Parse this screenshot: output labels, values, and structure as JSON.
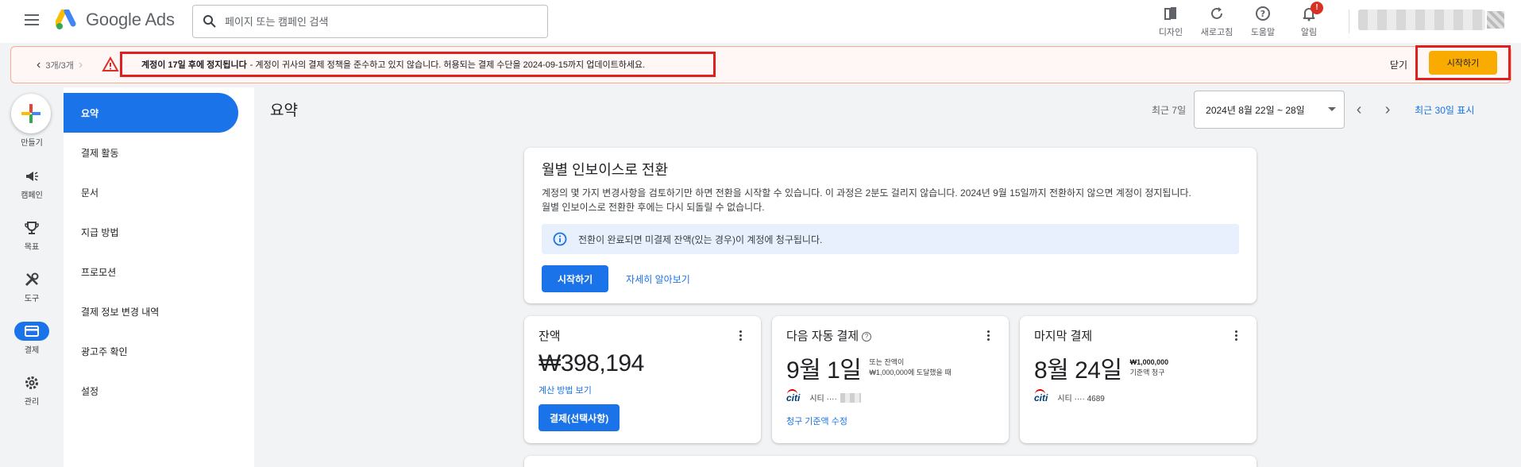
{
  "app": {
    "title": "Google Ads"
  },
  "search": {
    "placeholder": "페이지 또는 캠페인 검색"
  },
  "top_actions": [
    {
      "label": "디자인",
      "icon": "appearance-icon"
    },
    {
      "label": "새로고침",
      "icon": "refresh-icon"
    },
    {
      "label": "도움말",
      "icon": "help-icon"
    },
    {
      "label": "알림",
      "icon": "bell-icon",
      "badge": "!"
    }
  ],
  "banner": {
    "counter": "3개/3개",
    "headline": "계정이 17일 후에 정지됩니다",
    "message": "- 계정이 귀사의 결제 정책을 준수하고 있지 않습니다. 허용되는 결제 수단을 2024-09-15까지 업데이트하세요.",
    "close_label": "닫기",
    "cta_label": "시작하기"
  },
  "rail": {
    "create_label": "만들기",
    "items": [
      {
        "label": "캠페인",
        "icon": "megaphone-icon"
      },
      {
        "label": "목표",
        "icon": "trophy-icon"
      },
      {
        "label": "도구",
        "icon": "tools-icon"
      },
      {
        "label": "결제",
        "icon": "credit-card-icon",
        "active": true
      },
      {
        "label": "관리",
        "icon": "gear-icon"
      }
    ]
  },
  "subnav": {
    "items": [
      {
        "label": "요약",
        "active": true
      },
      {
        "label": "결제 활동"
      },
      {
        "label": "문서"
      },
      {
        "label": "지급 방법"
      },
      {
        "label": "프로모션"
      },
      {
        "label": "결제 정보 변경 내역"
      },
      {
        "label": "광고주 확인"
      },
      {
        "label": "설정"
      }
    ]
  },
  "main": {
    "title": "요약",
    "date_label": "최근 7일",
    "date_range": "2024년 8월 22일 ~ 28일",
    "show_30_days": "최근 30일 표시"
  },
  "invoice_card": {
    "title": "월별 인보이스로 전환",
    "body_line1": "계정의 몇 가지 변경사항을 검토하기만 하면 전환을 시작할 수 있습니다. 이 과정은 2분도 걸리지 않습니다. 2024년 9월 15일까지 전환하지 않으면 계정이 정지됩니다.",
    "body_line2": "월별 인보이스로 전환한 후에는 다시 되돌릴 수 없습니다.",
    "info": "전환이 완료되면 미결제 잔액(있는 경우)이 계정에 청구됩니다.",
    "start_label": "시작하기",
    "learn_more": "자세히 알아보기"
  },
  "balance_card": {
    "title": "잔액",
    "amount": "₩398,194",
    "link": "계산 방법 보기",
    "button": "결제(선택사항)"
  },
  "next_payment_card": {
    "title": "다음 자동 결제",
    "date": "9월 1일",
    "side_line1": "또는 잔액이",
    "side_line2": "₩1,000,000에 도달했을 때",
    "bank": "시티 ····",
    "link": "청구 기준액 수정"
  },
  "last_payment_card": {
    "title": "마지막 결제",
    "date": "8월 24일",
    "side_amount": "₩1,000,000",
    "side_line2": "기준액 청구",
    "bank": "시티 ···· 4689"
  },
  "colors": {
    "primary": "#1a73e8",
    "cta_yellow": "#f9ab00",
    "annotation_red": "#e0201f",
    "banner_bg": "#fef7f6"
  }
}
